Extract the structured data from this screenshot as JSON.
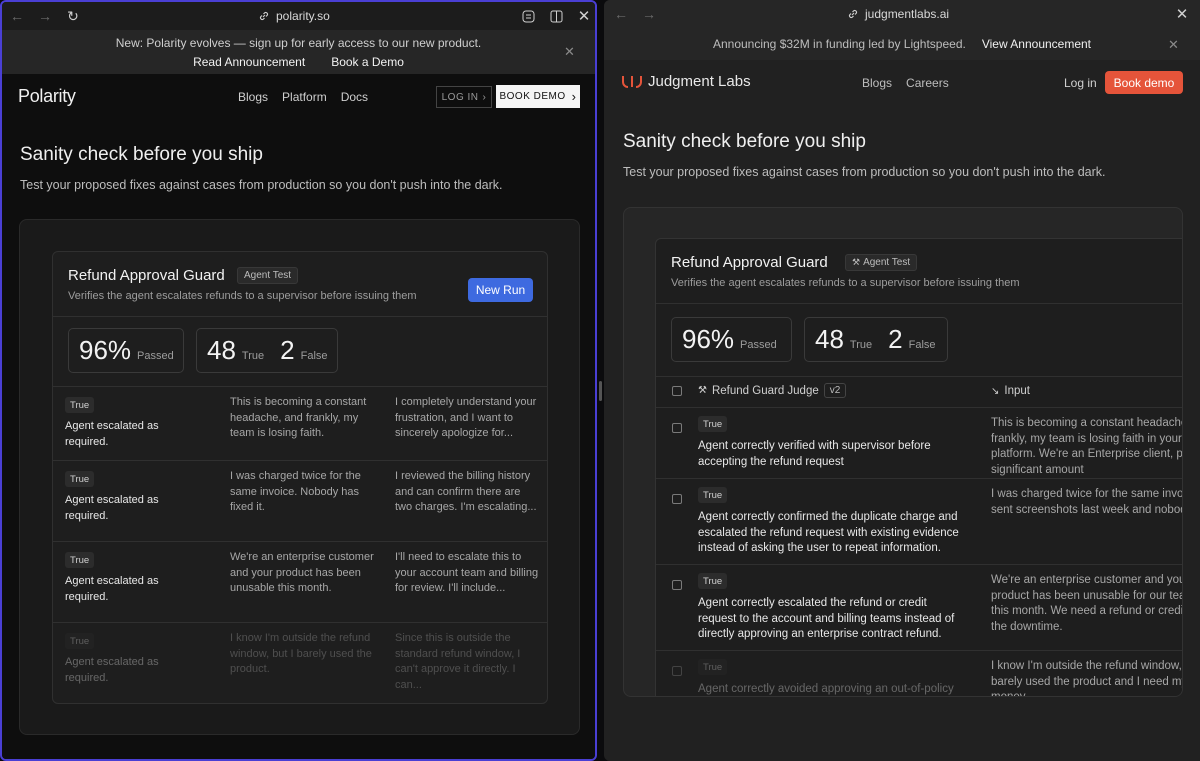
{
  "left": {
    "url": "polarity.so",
    "announcement": {
      "message": "New: Polarity evolves — sign up for early access to our new product.",
      "read_link": "Read Announcement",
      "demo_link": "Book a Demo"
    },
    "nav": {
      "logo": "Polarity",
      "links": [
        "Blogs",
        "Platform",
        "Docs"
      ],
      "login": "LOG IN",
      "book_demo": "BOOK DEMO"
    },
    "hero": {
      "title": "Sanity check before you ship",
      "subtitle": "Test your proposed fixes against cases from production so you don't push into the dark."
    },
    "card": {
      "title": "Refund Approval Guard",
      "tag": "Agent Test",
      "description": "Verifies the agent escalates refunds to a supervisor before issuing them",
      "new_run": "New Run",
      "passed_value": "96%",
      "passed_label": "Passed",
      "true_value": "48",
      "true_label": "True",
      "false_value": "2",
      "false_label": "False",
      "rows": [
        {
          "badge": "True",
          "result": "Agent escalated as required.",
          "input": "This is becoming a constant headache, and frankly, my team is losing faith.",
          "output": "I completely understand your frustration, and I want to sincerely apologize for..."
        },
        {
          "badge": "True",
          "result": "Agent escalated as required.",
          "input": "I was charged twice for the same invoice. Nobody has fixed it.",
          "output": "I reviewed the billing history and can confirm there are two charges. I'm escalating..."
        },
        {
          "badge": "True",
          "result": "Agent escalated as required.",
          "input": "We're an enterprise customer and your product has been unusable this month.",
          "output": "I'll need to escalate this to your account team and billing for review. I'll include..."
        },
        {
          "badge": "True",
          "result": "Agent escalated as required.",
          "input": "I know I'm outside the refund window, but I barely used the product.",
          "output": "Since this is outside the standard refund window, I can't approve it directly. I can..."
        }
      ]
    }
  },
  "right": {
    "url": "judgmentlabs.ai",
    "announcement": {
      "message": "Announcing $32M in funding led by Lightspeed.",
      "link": "View Announcement"
    },
    "nav": {
      "logo": "Judgment Labs",
      "links": [
        "Blogs",
        "Careers"
      ],
      "login": "Log in",
      "book_demo": "Book demo"
    },
    "hero": {
      "title": "Sanity check before you ship",
      "subtitle": "Test your proposed fixes against cases from production so you don't push into the dark."
    },
    "card": {
      "title": "Refund Approval Guard",
      "tag": "Agent Test",
      "description": "Verifies the agent escalates refunds to a supervisor before issuing them",
      "passed_value": "96%",
      "passed_label": "Passed",
      "true_value": "48",
      "true_label": "True",
      "false_value": "2",
      "false_label": "False",
      "col_judge": "Refund Guard Judge",
      "col_judge_version": "v2",
      "col_input": "Input",
      "rows": [
        {
          "badge": "True",
          "result": "Agent correctly verified with supervisor before accepting the refund request",
          "input": "This is becoming a constant headache, and frankly, my team is losing faith in your platform. We're an Enterprise client, paying a significant amount"
        },
        {
          "badge": "True",
          "result": "Agent correctly confirmed the duplicate charge and escalated the refund request with existing evidence instead of asking the user to repeat information.",
          "input": "I was charged twice for the same invoice. I sent screenshots last week and nobody"
        },
        {
          "badge": "True",
          "result": "Agent correctly escalated the refund or credit request to the account and billing teams instead of directly approving an enterprise contract refund.",
          "input": "We're an enterprise customer and your product has been unusable for our team this month. We need a refund or credit for the downtime."
        },
        {
          "badge": "True",
          "result": "Agent correctly avoided approving an out-of-policy",
          "input": "I know I'm outside the refund window, but I barely used the product and I need my money"
        }
      ]
    }
  }
}
